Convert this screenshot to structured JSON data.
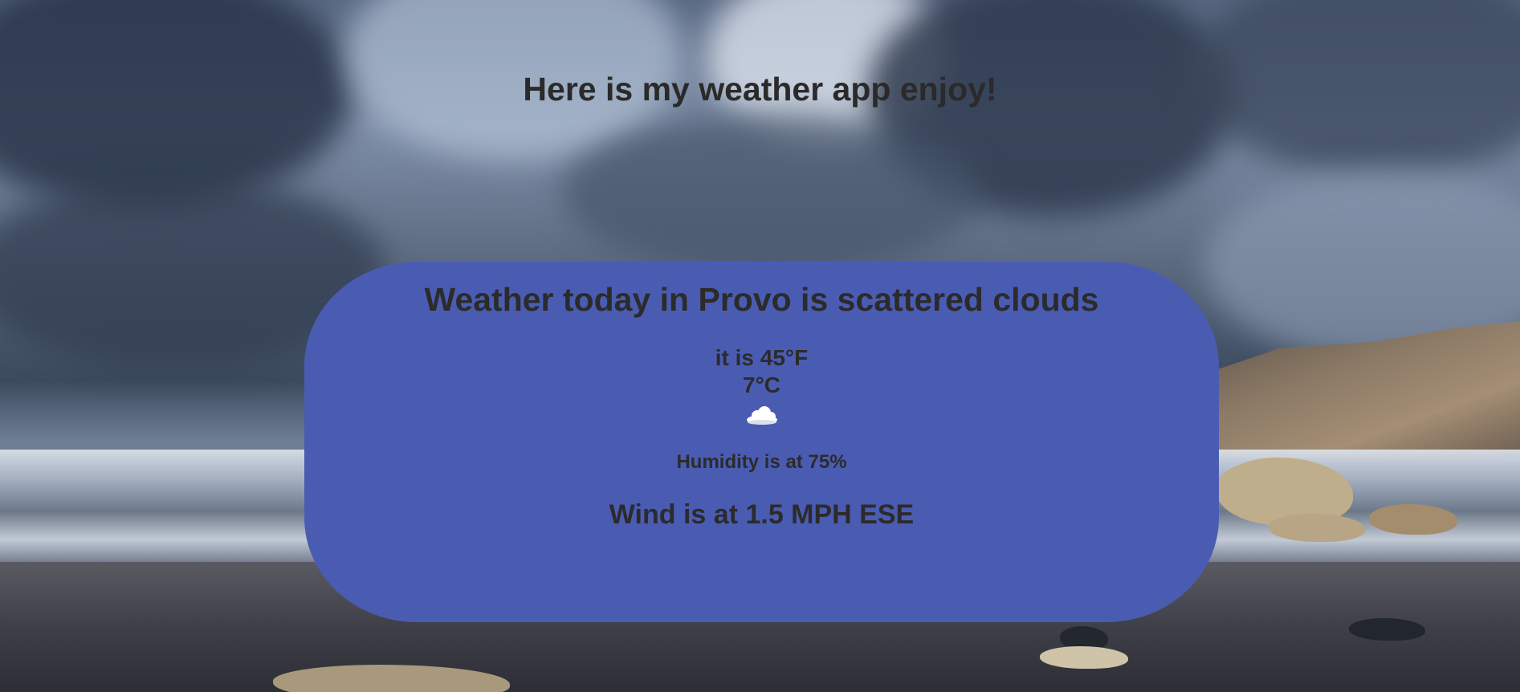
{
  "page": {
    "heading": "Here is my weather app enjoy!"
  },
  "weather": {
    "summary": "Weather today in Provo is scattered clouds",
    "temp_f": "it is 45°F",
    "temp_c": "7°C",
    "icon": "scattered-clouds-icon",
    "humidity": "Humidity is at 75%",
    "wind": "Wind is at 1.5 MPH ESE",
    "card_color": "#4a5cb2"
  }
}
